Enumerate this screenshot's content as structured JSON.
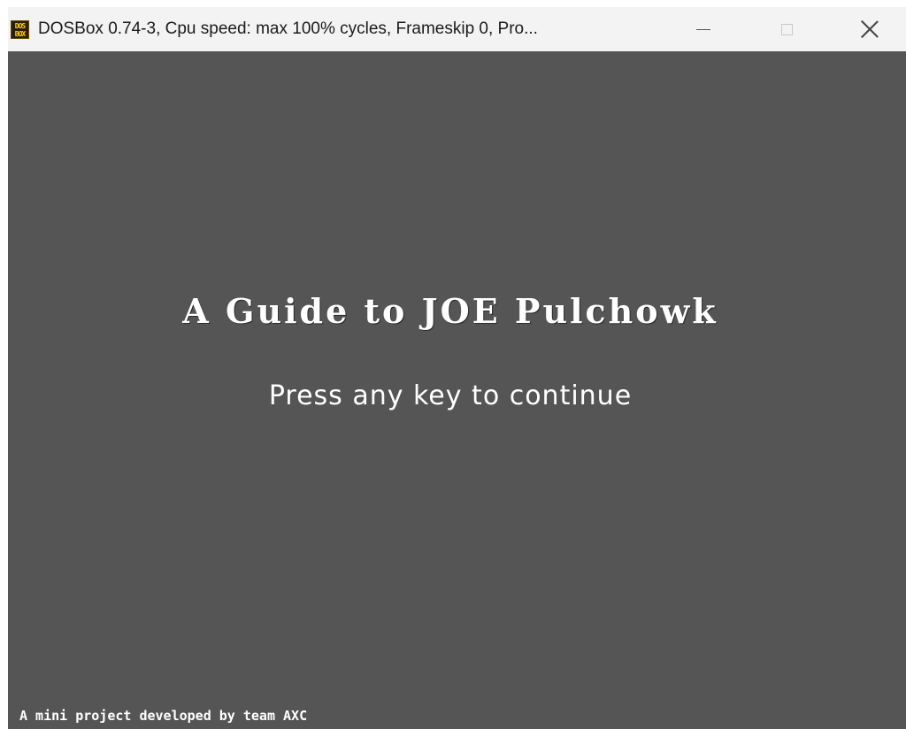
{
  "window": {
    "title": "DOSBox 0.74-3, Cpu speed: max 100% cycles, Frameskip  0, Pro...",
    "icon": {
      "name": "dosbox-icon",
      "line1": "DOS",
      "line2": "BOX"
    },
    "controls": {
      "minimize": "minimize-icon",
      "maximize": "maximize-icon",
      "close": "close-icon"
    }
  },
  "screen": {
    "title": "A Guide to JOE Pulchowk",
    "prompt": "Press any key to continue",
    "credits": "A mini project developed by team AXC",
    "background_color": "#555555",
    "text_color": "#ffffff"
  }
}
